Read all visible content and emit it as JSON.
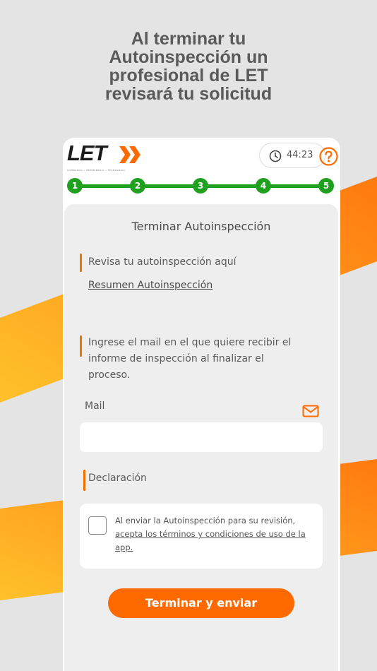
{
  "headline": "Al terminar tu\nAutoinspección un\nprofesional de LET\nrevisará tu solicitud",
  "header": {
    "logo_text": "LET",
    "logo_tagline": "LIDERAZGO • EXPERIENCIA • TECNOLOGÍA",
    "timer": "44:23",
    "help_icon": "question-circle-icon",
    "clock_icon": "clock-icon"
  },
  "steps": [
    "1",
    "2",
    "3",
    "4",
    "5"
  ],
  "main": {
    "title": "Terminar Autoinspección",
    "review_label": "Revisa tu autoinspección aquí",
    "review_link": "Resumen Autoinspección",
    "email_instruction": "Ingrese el mail en el que quiere recibir el informe de inspección al finalizar el proceso.",
    "mail_label": "Mail",
    "mail_icon": "mail-icon",
    "mail_value": "",
    "declaration_label": "Declaración",
    "declaration_text_1": "Al enviar la Autoinspección para su revisión, ",
    "declaration_link": "acepta los términos y condiciones de uso de la app.",
    "submit_label": "Terminar y enviar"
  },
  "colors": {
    "accent": "#ff6a00",
    "step_green": "#1fa01f",
    "background": "#e4e4e4",
    "stripe_yellow": "#ffc12b"
  }
}
